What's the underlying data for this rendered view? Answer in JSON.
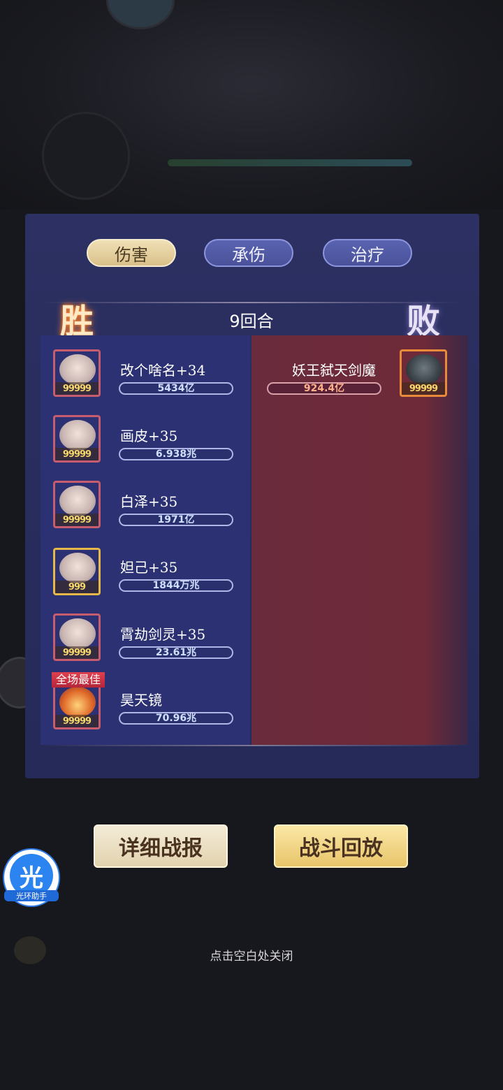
{
  "tabs": [
    {
      "label": "伤害",
      "active": true
    },
    {
      "label": "承伤",
      "active": false
    },
    {
      "label": "治疗",
      "active": false
    }
  ],
  "battle": {
    "left_result": "胜",
    "right_result": "败",
    "rounds": "9回合"
  },
  "allies": [
    {
      "name": "改个啥名+34",
      "value": "5434亿",
      "stars": "99999"
    },
    {
      "name": "画皮+35",
      "value": "6.938兆",
      "stars": "99999"
    },
    {
      "name": "白泽+35",
      "value": "1971亿",
      "stars": "99999"
    },
    {
      "name": "妲己+35",
      "value": "1844万兆",
      "stars": "999"
    },
    {
      "name": "霄劫剑灵+35",
      "value": "23.61兆",
      "stars": "99999"
    },
    {
      "name": "昊天镜",
      "value": "70.96兆",
      "stars": "99999",
      "badge": "全场最佳"
    }
  ],
  "enemies": [
    {
      "name": "妖王弑天剑魔",
      "value": "924.4亿",
      "stars": "99999"
    }
  ],
  "buttons": {
    "detail": "详细战报",
    "replay": "战斗回放"
  },
  "close_hint": "点击空白处关闭",
  "helper": {
    "glyph": "光",
    "label": "光环助手"
  },
  "colors": {
    "ally_column": "#2b3172",
    "enemy_column": "#6a2b3c",
    "accent_gold": "#e8c56a"
  }
}
